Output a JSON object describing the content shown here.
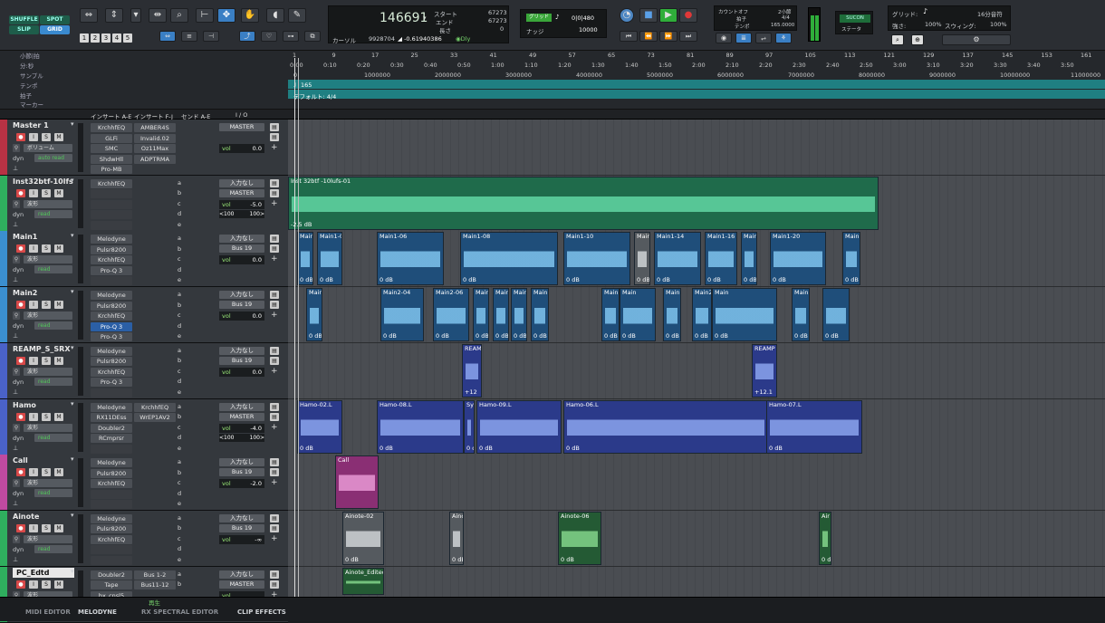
{
  "mode_buttons": {
    "shuffle": "SHUFFLE",
    "spot": "SPOT",
    "slip": "SLIP",
    "grid": "GRID"
  },
  "zoom_presets": [
    "1",
    "2",
    "3",
    "4",
    "5"
  ],
  "counter": {
    "main": "146691",
    "start_label": "スタート",
    "end_label": "エンド",
    "length_label": "長さ",
    "start": "67273",
    "end": "67273",
    "length": "0",
    "cursor_label": "カーソル",
    "cursor": "9928704",
    "cursor_gain": "-0.61940386",
    "dly": "Dly"
  },
  "nudge": {
    "label": "ナッジ",
    "grid_label": "グリッド",
    "grid_val": "0|0|480",
    "nudge_val": "10000"
  },
  "transport": {
    "count_label": "カウントオフ",
    "meter_label": "拍子",
    "tempo_label": "テンポ",
    "count": "2小節",
    "meter": "4/4",
    "tempo": "165.0000"
  },
  "sync": {
    "label": "SUCON",
    "sub": "ステータ"
  },
  "grid_panel": {
    "grid_label": "グリッド:",
    "grid_value": "16分音符",
    "strength_label": "強さ:",
    "strength": "100%",
    "swing_label": "スウィング:",
    "swing": "100%"
  },
  "rulers": {
    "labels": [
      "小節|拍",
      "分:秒",
      "サンプル",
      "テンポ",
      "拍子",
      "マーカー"
    ],
    "tempo_value": "165",
    "meter_value": "デフォルト: 4/4"
  },
  "ruler_bars": [
    "1",
    "9",
    "17",
    "25",
    "33",
    "41",
    "49",
    "57",
    "65",
    "73",
    "81",
    "89",
    "97",
    "105",
    "113",
    "121",
    "129",
    "137",
    "145",
    "153",
    "161"
  ],
  "ruler_times": [
    "0:00",
    "0:10",
    "0:20",
    "0:30",
    "0:40",
    "0:50",
    "1:00",
    "1:10",
    "1:20",
    "1:30",
    "1:40",
    "1:50",
    "2:00",
    "2:10",
    "2:20",
    "2:30",
    "2:40",
    "2:50",
    "3:00",
    "3:10",
    "3:20",
    "3:30",
    "3:40",
    "3:50"
  ],
  "ruler_samples": [
    "0",
    "1000000",
    "2000000",
    "3000000",
    "4000000",
    "5000000",
    "6000000",
    "7000000",
    "8000000",
    "9000000",
    "10000000",
    "11000000"
  ],
  "headers": {
    "inserts_ae": "インサート A-E",
    "inserts_fj": "インサート F-J",
    "sends": "センド A-E",
    "io": "I / O"
  },
  "tracks": [
    {
      "name": "Master 1",
      "color": "#b83244",
      "sel": false,
      "mode": "ボリューム",
      "auto": "auto read",
      "inserts": [
        "KrchhfEQ",
        "GLFi",
        "SMC",
        "ShdwHll",
        "Pro-MB"
      ],
      "inserts2": [
        "AMBER4S",
        "Invalid.02",
        "Oz11Max",
        "ADPTRMA"
      ],
      "sends": [],
      "io1": "MASTER",
      "io2": "",
      "vol": "0.0",
      "pan": [
        "",
        ""
      ]
    },
    {
      "name": "Inst32btf-10lfs",
      "color": "#2fae5e",
      "sel": false,
      "mode": "波形",
      "auto": "read",
      "inserts": [
        "KrchhfEQ",
        "",
        "",
        "",
        ""
      ],
      "inserts2": [],
      "sends": [
        "a",
        "b",
        "c",
        "d",
        "e"
      ],
      "io1": "入力なし",
      "io2": "MASTER",
      "vol": "-5.0",
      "pan": [
        "<100",
        "100>"
      ]
    },
    {
      "name": "Main1",
      "color": "#3b8fd0",
      "sel": false,
      "mode": "波形",
      "auto": "read",
      "inserts": [
        "Melodyne",
        "Pulsr8200",
        "KrchhfEQ",
        "Pro-Q 3",
        ""
      ],
      "inserts2": [],
      "sends": [
        "a",
        "b",
        "c",
        "d",
        "e"
      ],
      "io1": "入力なし",
      "io2": "Bus 19",
      "vol": "0.0",
      "pan": [
        "",
        ""
      ]
    },
    {
      "name": "Main2",
      "color": "#3b8fd0",
      "sel": false,
      "mode": "波形",
      "auto": "read",
      "inserts": [
        "Melodyne",
        "Pulsr8200",
        "KrchhfEQ",
        "Pro-Q 3",
        "Pro-Q 3"
      ],
      "inserts2": [],
      "sends": [
        "a",
        "b",
        "c",
        "d",
        "e"
      ],
      "io1": "入力なし",
      "io2": "Bus 19",
      "vol": "0.0",
      "pan": [
        "",
        ""
      ]
    },
    {
      "name": "REAMP_S_SRX",
      "color": "#4a62c8",
      "sel": false,
      "mode": "波形",
      "auto": "read",
      "inserts": [
        "Melodyne",
        "Pulsr8200",
        "KrchhfEQ",
        "Pro-Q 3",
        ""
      ],
      "inserts2": [],
      "sends": [
        "a",
        "b",
        "c",
        "d",
        "e"
      ],
      "io1": "入力なし",
      "io2": "Bus 19",
      "vol": "0.0",
      "pan": [
        "",
        ""
      ]
    },
    {
      "name": "Hamo",
      "color": "#4a62c8",
      "sel": false,
      "mode": "波形",
      "auto": "read",
      "inserts": [
        "Melodyne",
        "RX11DEss",
        "Doubler2",
        "RCmprsr",
        ""
      ],
      "inserts2": [
        "KrchhfEQ",
        "WrEP1AV2"
      ],
      "sends": [
        "a",
        "b",
        "c",
        "d",
        "e"
      ],
      "io1": "入力なし",
      "io2": "MASTER",
      "vol": "-4.0",
      "pan": [
        "<100",
        "100>"
      ]
    },
    {
      "name": "Call",
      "color": "#c04aa0",
      "sel": false,
      "mode": "波形",
      "auto": "read",
      "inserts": [
        "Melodyne",
        "Pulsr8200",
        "KrchhfEQ",
        "",
        ""
      ],
      "inserts2": [],
      "sends": [
        "a",
        "b",
        "c",
        "d",
        "e"
      ],
      "io1": "入力なし",
      "io2": "Bus 19",
      "vol": "-2.0",
      "pan": [
        "",
        ""
      ]
    },
    {
      "name": "Ainote",
      "color": "#2fae5e",
      "sel": false,
      "mode": "波形",
      "auto": "read",
      "inserts": [
        "Melodyne",
        "Pulsr8200",
        "KrchhfEQ",
        "",
        ""
      ],
      "inserts2": [],
      "sends": [
        "a",
        "b",
        "c",
        "d",
        "e"
      ],
      "io1": "入力なし",
      "io2": "Bus 19",
      "vol": "-∞",
      "pan": [
        "",
        ""
      ]
    },
    {
      "name": "PC_Edtd",
      "color": "#2fae5e",
      "sel": true,
      "mode": "波形",
      "auto": "",
      "inserts": [
        "Doubler2",
        "Tape",
        "bx_cnsl5",
        "",
        ""
      ],
      "inserts2": [
        "Bus 1-2",
        "Bus11-12"
      ],
      "sends": [
        "a",
        "b"
      ],
      "io1": "入力なし",
      "io2": "MASTER",
      "vol": "",
      "pan": [
        "",
        ""
      ]
    }
  ],
  "dyn_label": "dyn",
  "play_label": "再生",
  "bottom_tabs": [
    "MIDI EDITOR",
    "MELODYNE",
    "RX SPECTRAL EDITOR",
    "CLIP EFFECTS"
  ],
  "clips": {
    "inst": {
      "name": "Inst 32btf -10lufs-01",
      "gain": "-2.5 dB"
    },
    "main1": [
      "Main",
      "Main1-0",
      "Main1-06",
      "Main1-08",
      "Main1-10",
      "Main",
      "Main1-14",
      "Main1-16",
      "Main",
      "Main1-20",
      "Main1"
    ],
    "main2": [
      "Main",
      "Main2-04",
      "Main2-06",
      "Main",
      "Main",
      "Main",
      "Main",
      "Main2-18",
      "Main",
      "Main",
      "Main2-24",
      "Main",
      "Main2-2"
    ],
    "reamp": [
      "REAM",
      "REAMP"
    ],
    "reamp_gain": [
      "+12",
      "+12.1"
    ],
    "hamo": [
      "Hamo-02.L",
      "Hamo-08.L",
      "Sy",
      "Hamo-09.L",
      "Hamo-06.L",
      "Hamo-07.L"
    ],
    "call": "Call",
    "ainote": [
      "Ainote-02",
      "Ainc",
      "Ainote-06",
      "Air"
    ],
    "pc": "Ainote_Edited",
    "zero_db": "0 dB"
  }
}
